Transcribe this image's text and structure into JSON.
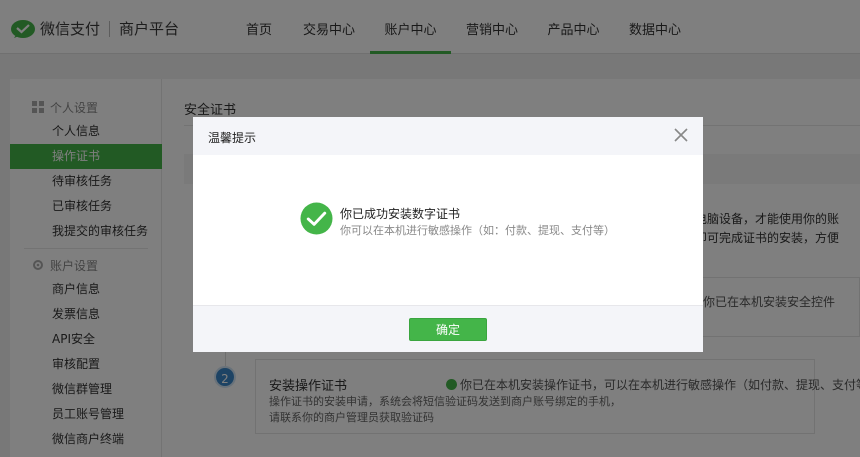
{
  "header": {
    "brand": "微信支付",
    "platform": "商户平台",
    "nav": [
      {
        "label": "首页",
        "active": false
      },
      {
        "label": "交易中心",
        "active": false
      },
      {
        "label": "账户中心",
        "active": true
      },
      {
        "label": "营销中心",
        "active": false
      },
      {
        "label": "产品中心",
        "active": false
      },
      {
        "label": "数据中心",
        "active": false
      }
    ]
  },
  "sidebar": {
    "group1": {
      "title": "个人设置",
      "items": [
        "个人信息",
        "操作证书",
        "待审核任务",
        "已审核任务",
        "我提交的审核任务"
      ]
    },
    "group2": {
      "title": "账户设置",
      "items": [
        "商户信息",
        "发票信息",
        "API安全",
        "审核配置",
        "微信群管理",
        "员工账号管理",
        "微信商户终端"
      ]
    }
  },
  "content": {
    "title": "安全证书",
    "partial_right_1": "台电脑设备，才能使用你的账",
    "partial_right_2": "，即可完成证书的安装，方便",
    "partial_step1_status": "你已在本机安装安全控件",
    "step2": {
      "number": "2",
      "title": "安装操作证书",
      "status": "你已在本机安装操作证书，可以在本机进行敏感操作（如付款、提现、支付等）",
      "desc1": "操作证书的安装申请，系统会将短信验证码发送到商户账号绑定的手机，",
      "desc2": "请联系你的商户管理员获取验证码"
    }
  },
  "dialog": {
    "title": "温馨提示",
    "message": "你已成功安装数字证书",
    "submessage": "你可以在本机进行敏感操作（如：付款、提现、支付等）",
    "confirm_label": "确定"
  },
  "colors": {
    "accent": "#44b549",
    "overlay": "rgba(0,0,0,0.5)",
    "step_blue": "#3a87c8"
  }
}
